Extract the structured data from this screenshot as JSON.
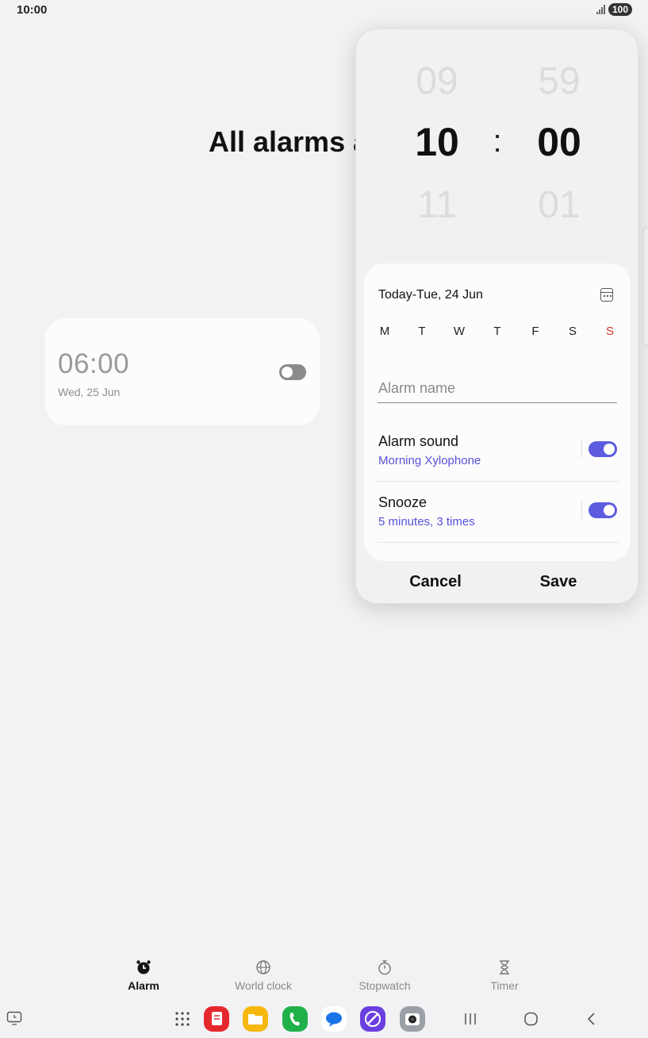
{
  "status_bar": {
    "time": "10:00",
    "battery": "100"
  },
  "page": {
    "title": "All alarms a"
  },
  "alarm_card": {
    "time": "06:00",
    "date": "Wed, 25 Jun"
  },
  "picker": {
    "hour_prev": "09",
    "hour_selected": "10",
    "hour_next": "11",
    "minute_prev": "59",
    "minute_selected": "00",
    "minute_next": "01",
    "separator": ":"
  },
  "settings": {
    "date_label": "Today-Tue, 24 Jun",
    "days": [
      "M",
      "T",
      "W",
      "T",
      "F",
      "S",
      "S"
    ],
    "alarm_name_placeholder": "Alarm name",
    "alarm_sound": {
      "title": "Alarm sound",
      "value": "Morning Xylophone",
      "enabled": true
    },
    "snooze": {
      "title": "Snooze",
      "value": "5 minutes, 3 times",
      "enabled": true
    }
  },
  "actions": {
    "cancel": "Cancel",
    "save": "Save"
  },
  "tabs": [
    {
      "label": "Alarm",
      "icon": "alarm-clock-icon",
      "active": true
    },
    {
      "label": "World clock",
      "icon": "globe-icon",
      "active": false
    },
    {
      "label": "Stopwatch",
      "icon": "stopwatch-icon",
      "active": false
    },
    {
      "label": "Timer",
      "icon": "hourglass-icon",
      "active": false
    }
  ],
  "dock": {
    "apps": [
      "app-grid-icon",
      "notes-app-icon",
      "files-app-icon",
      "phone-app-icon",
      "messages-app-icon",
      "browser-app-icon",
      "camera-app-icon"
    ],
    "colors": {
      "accent": "#5d5ce0",
      "sunday": "#d0342c"
    }
  }
}
